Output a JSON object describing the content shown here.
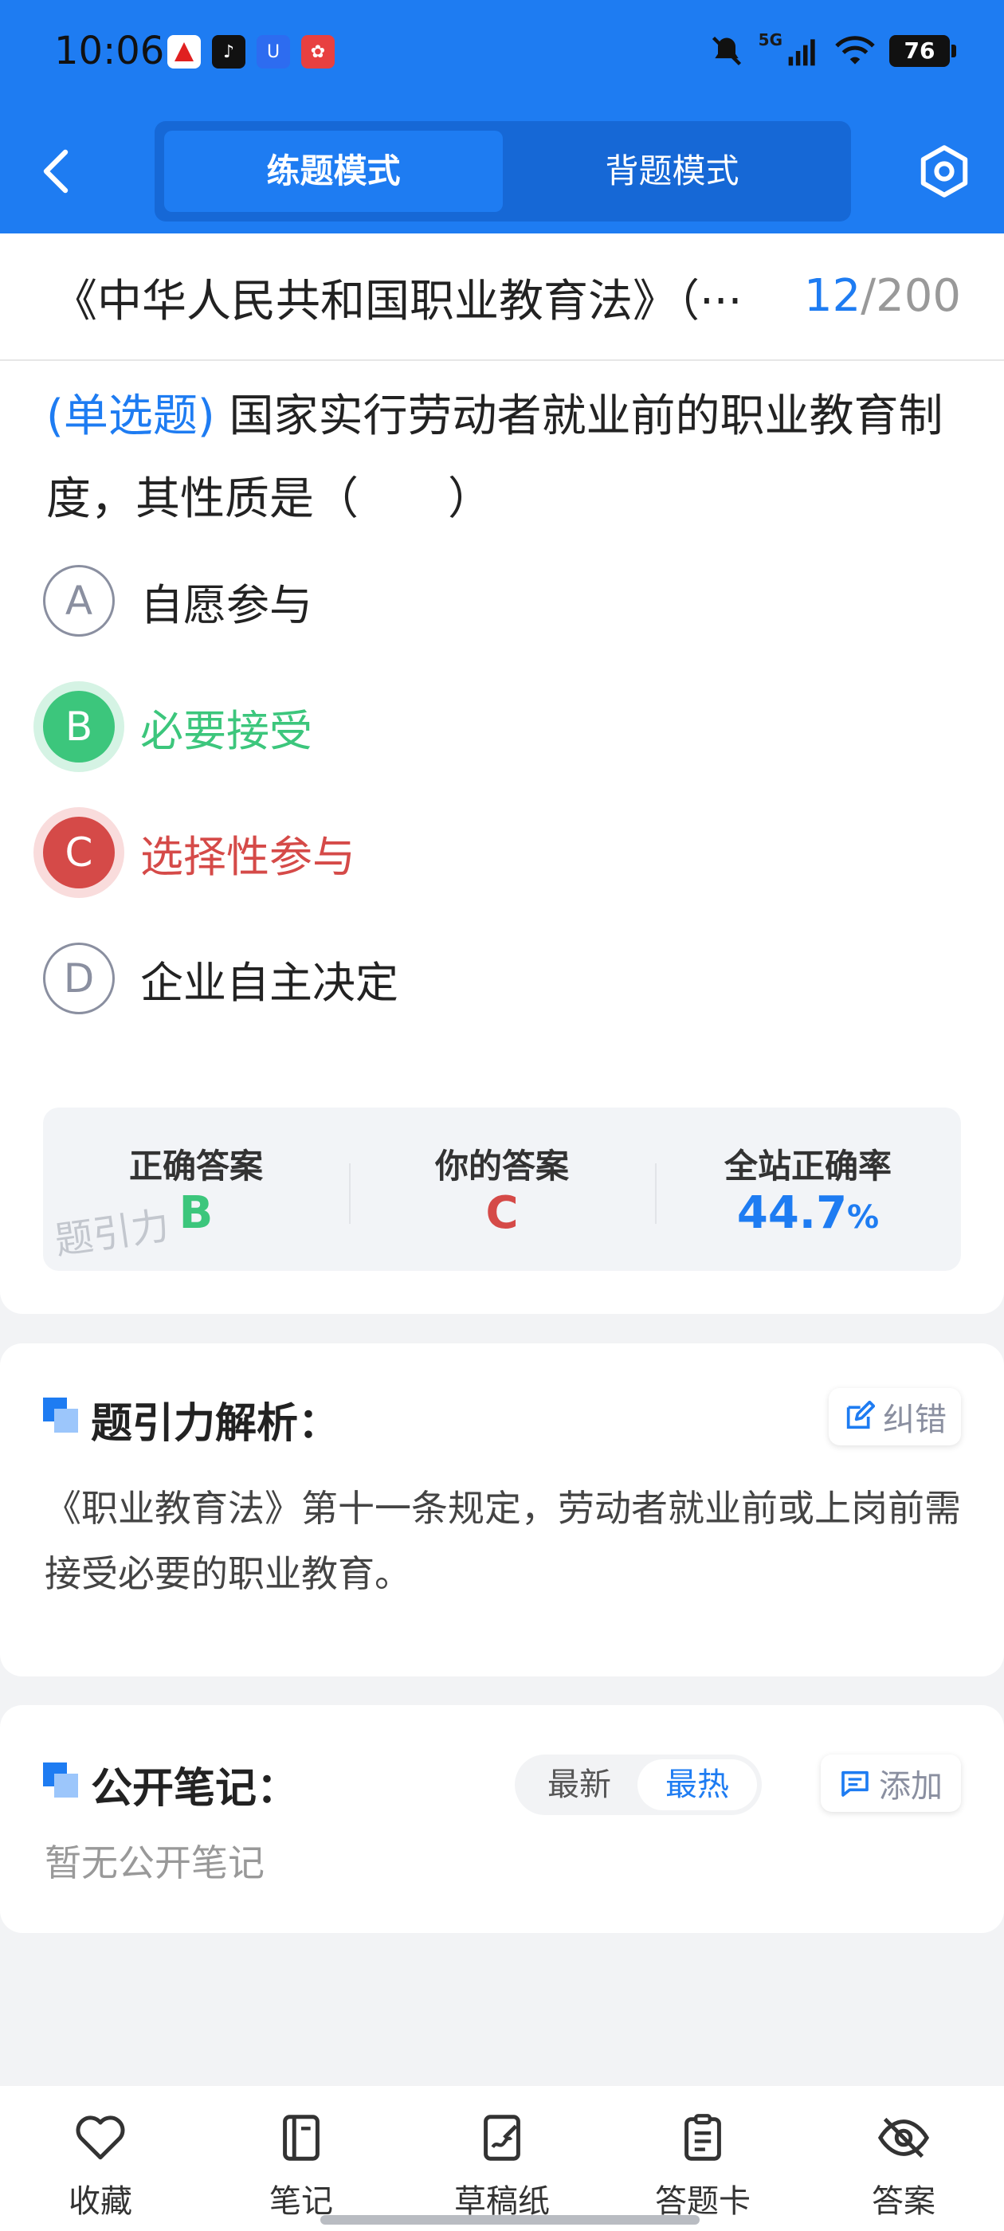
{
  "status_bar": {
    "time": "10:06",
    "network": "5G",
    "battery": "76"
  },
  "header": {
    "modes": [
      "练题模式",
      "背题模式"
    ],
    "active_mode": "练题模式"
  },
  "title_row": {
    "title": "《中华人民共和国职业教育法》（···",
    "current": "12",
    "separator": "/",
    "total": "200"
  },
  "question": {
    "type": "(单选题)",
    "text": "国家实行劳动者就业前的职业教育制度，其性质是（　　）",
    "options": [
      {
        "letter": "A",
        "text": "自愿参与",
        "state": "normal"
      },
      {
        "letter": "B",
        "text": "必要接受",
        "state": "correct"
      },
      {
        "letter": "C",
        "text": "选择性参与",
        "state": "wrong"
      },
      {
        "letter": "D",
        "text": "企业自主决定",
        "state": "normal"
      }
    ]
  },
  "answer_summary": {
    "correct_label": "正确答案",
    "correct_value": "B",
    "yours_label": "你的答案",
    "yours_value": "C",
    "rate_label": "全站正确率",
    "rate_value": "44.7",
    "rate_unit": "%",
    "watermark": "题引力"
  },
  "analysis": {
    "title": "题引力解析：",
    "report_label": "纠错",
    "text": "《职业教育法》第十一条规定，劳动者就业前或上岗前需接受必要的职业教育。"
  },
  "notes": {
    "title": "公开笔记：",
    "sort_options": [
      "最新",
      "最热"
    ],
    "active_sort": "最热",
    "add_label": "添加",
    "empty_text": "暂无公开笔记"
  },
  "bottom_nav": [
    {
      "label": "收藏",
      "icon": "heart-icon"
    },
    {
      "label": "笔记",
      "icon": "notebook-icon"
    },
    {
      "label": "草稿纸",
      "icon": "draft-paper-icon"
    },
    {
      "label": "答题卡",
      "icon": "answer-sheet-icon"
    },
    {
      "label": "答案",
      "icon": "eye-off-icon"
    }
  ],
  "colors": {
    "brand_blue": "#1e7cf2",
    "correct_green": "#3cc67c",
    "wrong_red": "#d54a48"
  }
}
